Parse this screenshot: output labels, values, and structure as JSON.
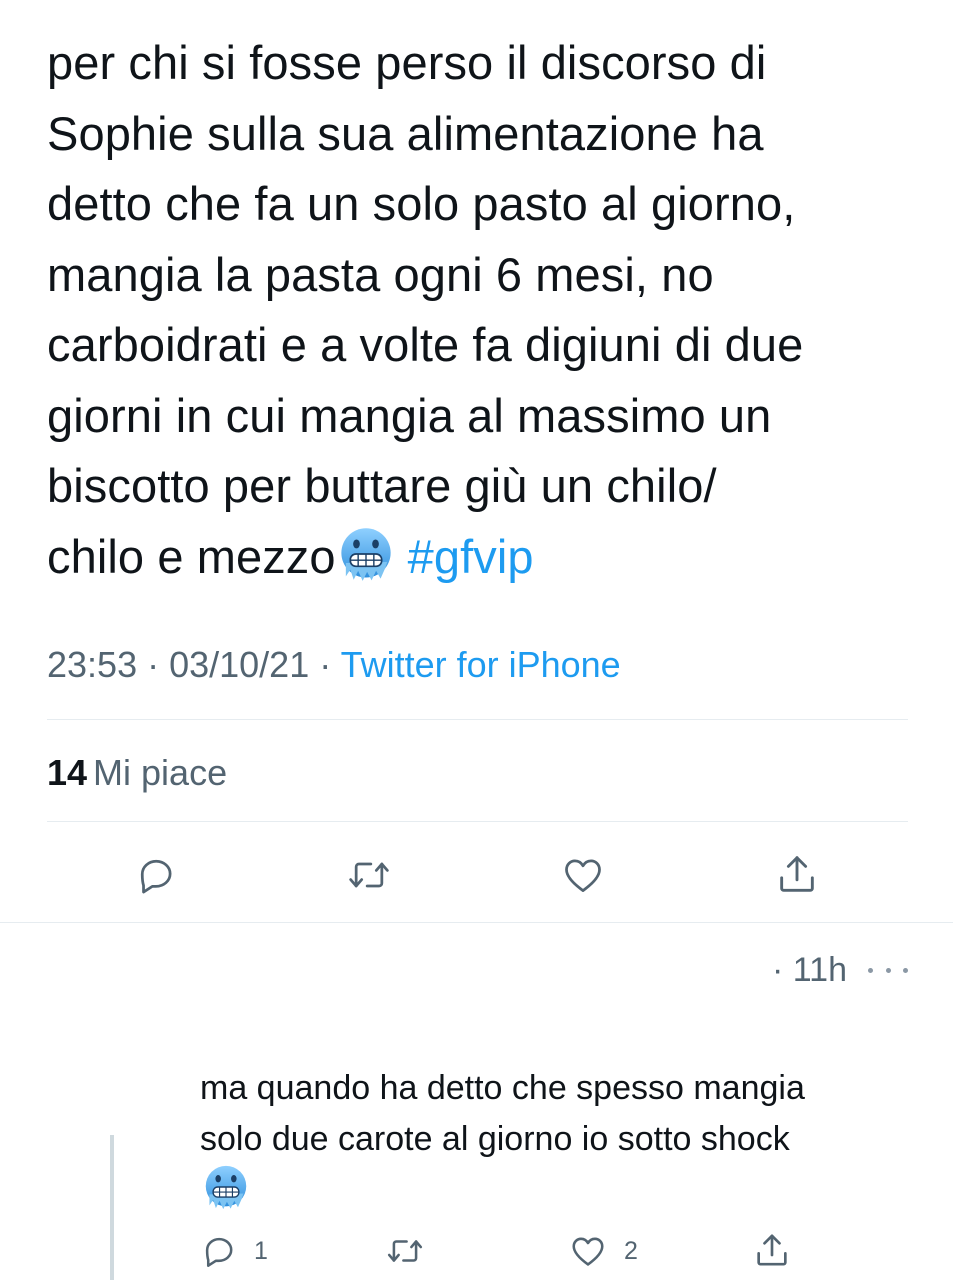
{
  "tweet": {
    "lines": [
      "per chi si fosse perso il discorso di",
      "Sophie sulla sua alimentazione ha",
      "detto che fa un solo pasto al giorno,",
      "mangia la pasta ogni 6 mesi, no",
      "carboidrati e a volte fa digiuni di due",
      "giorni in cui mangia al massimo un",
      "biscotto per buttare giù un chilo/",
      "chilo e mezzo"
    ],
    "emoji": "cold-face-emoji",
    "hashtag": "#gfvip",
    "time": "23:53",
    "separator": " · ",
    "date": "03/10/21",
    "source": "Twitter for iPhone"
  },
  "stats": {
    "likes_count": "14",
    "likes_label": "Mi piace"
  },
  "actions": [
    "reply-icon",
    "retweet-icon",
    "heart-icon",
    "share-icon"
  ],
  "reply": {
    "time": "· 11h",
    "lines": [
      "ma quando ha detto che spesso mangia",
      "solo due carote al giorno io sotto shock"
    ],
    "emoji": "cold-face-emoji",
    "reply_count": "1",
    "like_count": "2"
  },
  "colors": {
    "text": "#0f1419",
    "secondary": "#536471",
    "accent": "#1d9bf0",
    "divider": "#e6ecf0",
    "emoji_face": "#3f9fe0"
  }
}
